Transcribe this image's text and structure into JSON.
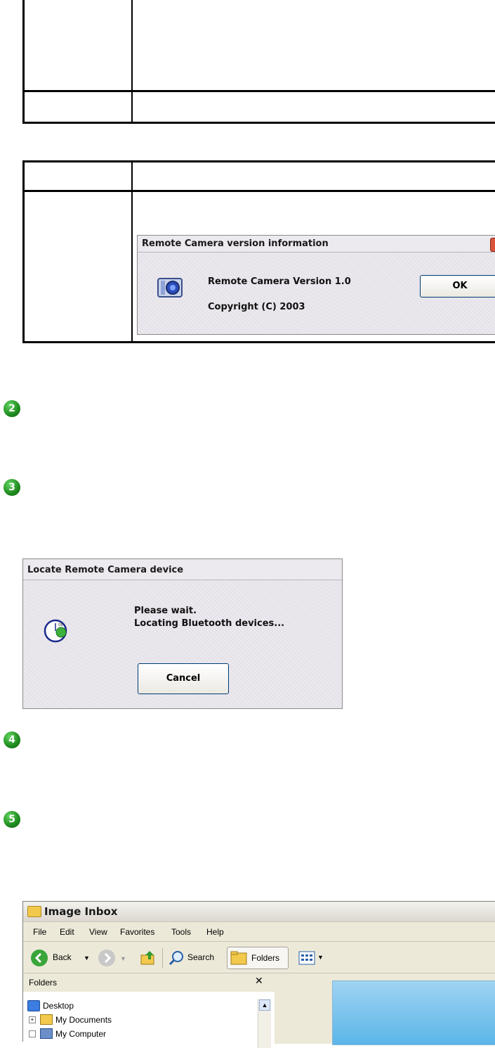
{
  "version_dialog": {
    "title": "Remote Camera version information",
    "product_line": "Remote Camera Version 1.0",
    "copyright": "Copyright (C) 2003",
    "ok_label": "OK",
    "close_icon": "close-icon"
  },
  "steps": [
    "2",
    "3",
    "4",
    "5"
  ],
  "locate_dialog": {
    "title": "Locate Remote Camera device",
    "message_line1": "Please wait.",
    "message_line2": "Locating Bluetooth devices...",
    "cancel_label": "Cancel",
    "icon": "bluetooth-search-icon"
  },
  "explorer": {
    "title": "Image Inbox",
    "menu": [
      "File",
      "Edit",
      "View",
      "Favorites",
      "Tools",
      "Help"
    ],
    "toolbar": {
      "back": "Back",
      "search": "Search",
      "folders": "Folders"
    },
    "folders_pane": {
      "header": "Folders",
      "items": [
        "Desktop",
        "My Documents",
        "My Computer"
      ]
    }
  }
}
